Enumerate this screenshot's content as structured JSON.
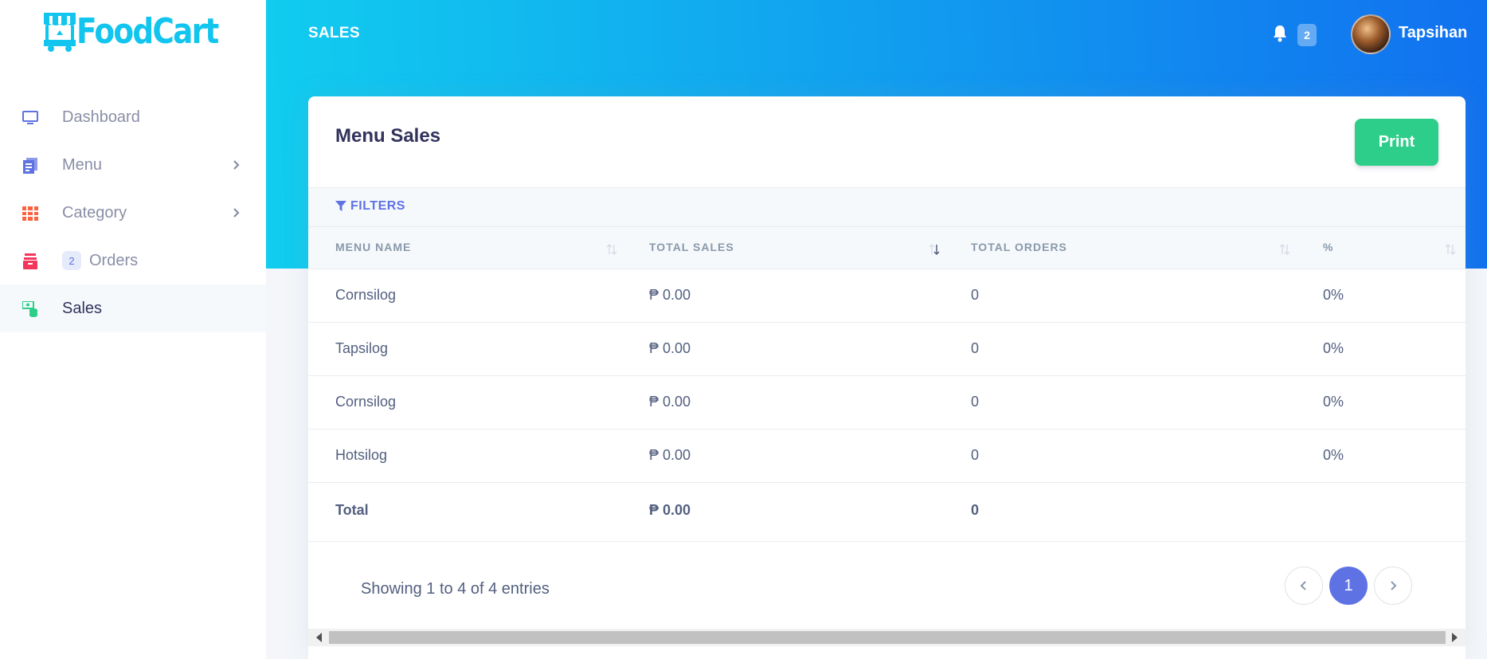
{
  "app": {
    "logo_text": "FoodCart"
  },
  "sidebar": {
    "items": [
      {
        "label": "Dashboard",
        "icon": "monitor-icon",
        "color": "#5e72e4"
      },
      {
        "label": "Menu",
        "icon": "document-icon",
        "color": "#5e72e4",
        "has_submenu": true
      },
      {
        "label": "Category",
        "icon": "grid-icon",
        "color": "#fb6340",
        "has_submenu": true
      },
      {
        "label": "Orders",
        "icon": "basket-icon",
        "color": "#f5365c",
        "badge": "2"
      },
      {
        "label": "Sales",
        "icon": "money-icon",
        "color": "#2dce89",
        "active": true
      }
    ]
  },
  "header": {
    "title": "SALES",
    "notification_count": "2",
    "user_name": "Tapsihan"
  },
  "card": {
    "title": "Menu Sales",
    "print_label": "Print",
    "filters_label": "FILTERS"
  },
  "table": {
    "columns": [
      "MENU NAME",
      "TOTAL SALES",
      "TOTAL ORDERS",
      "%"
    ],
    "rows": [
      {
        "name": "Cornsilog",
        "sales": "₱ 0.00",
        "orders": "0",
        "pct": "0%"
      },
      {
        "name": "Tapsilog",
        "sales": "₱ 0.00",
        "orders": "0",
        "pct": "0%"
      },
      {
        "name": "Cornsilog",
        "sales": "₱ 0.00",
        "orders": "0",
        "pct": "0%"
      },
      {
        "name": "Hotsilog",
        "sales": "₱ 0.00",
        "orders": "0",
        "pct": "0%"
      }
    ],
    "total": {
      "label": "Total",
      "sales": "₱ 0.00",
      "orders": "0"
    }
  },
  "pagination": {
    "summary": "Showing 1 to 4 of 4 entries",
    "current_page": "1"
  },
  "colors": {
    "header_gradient_start": "#11cdef",
    "header_gradient_end": "#1171ef",
    "primary": "#5e72e4",
    "success": "#2dce89"
  }
}
